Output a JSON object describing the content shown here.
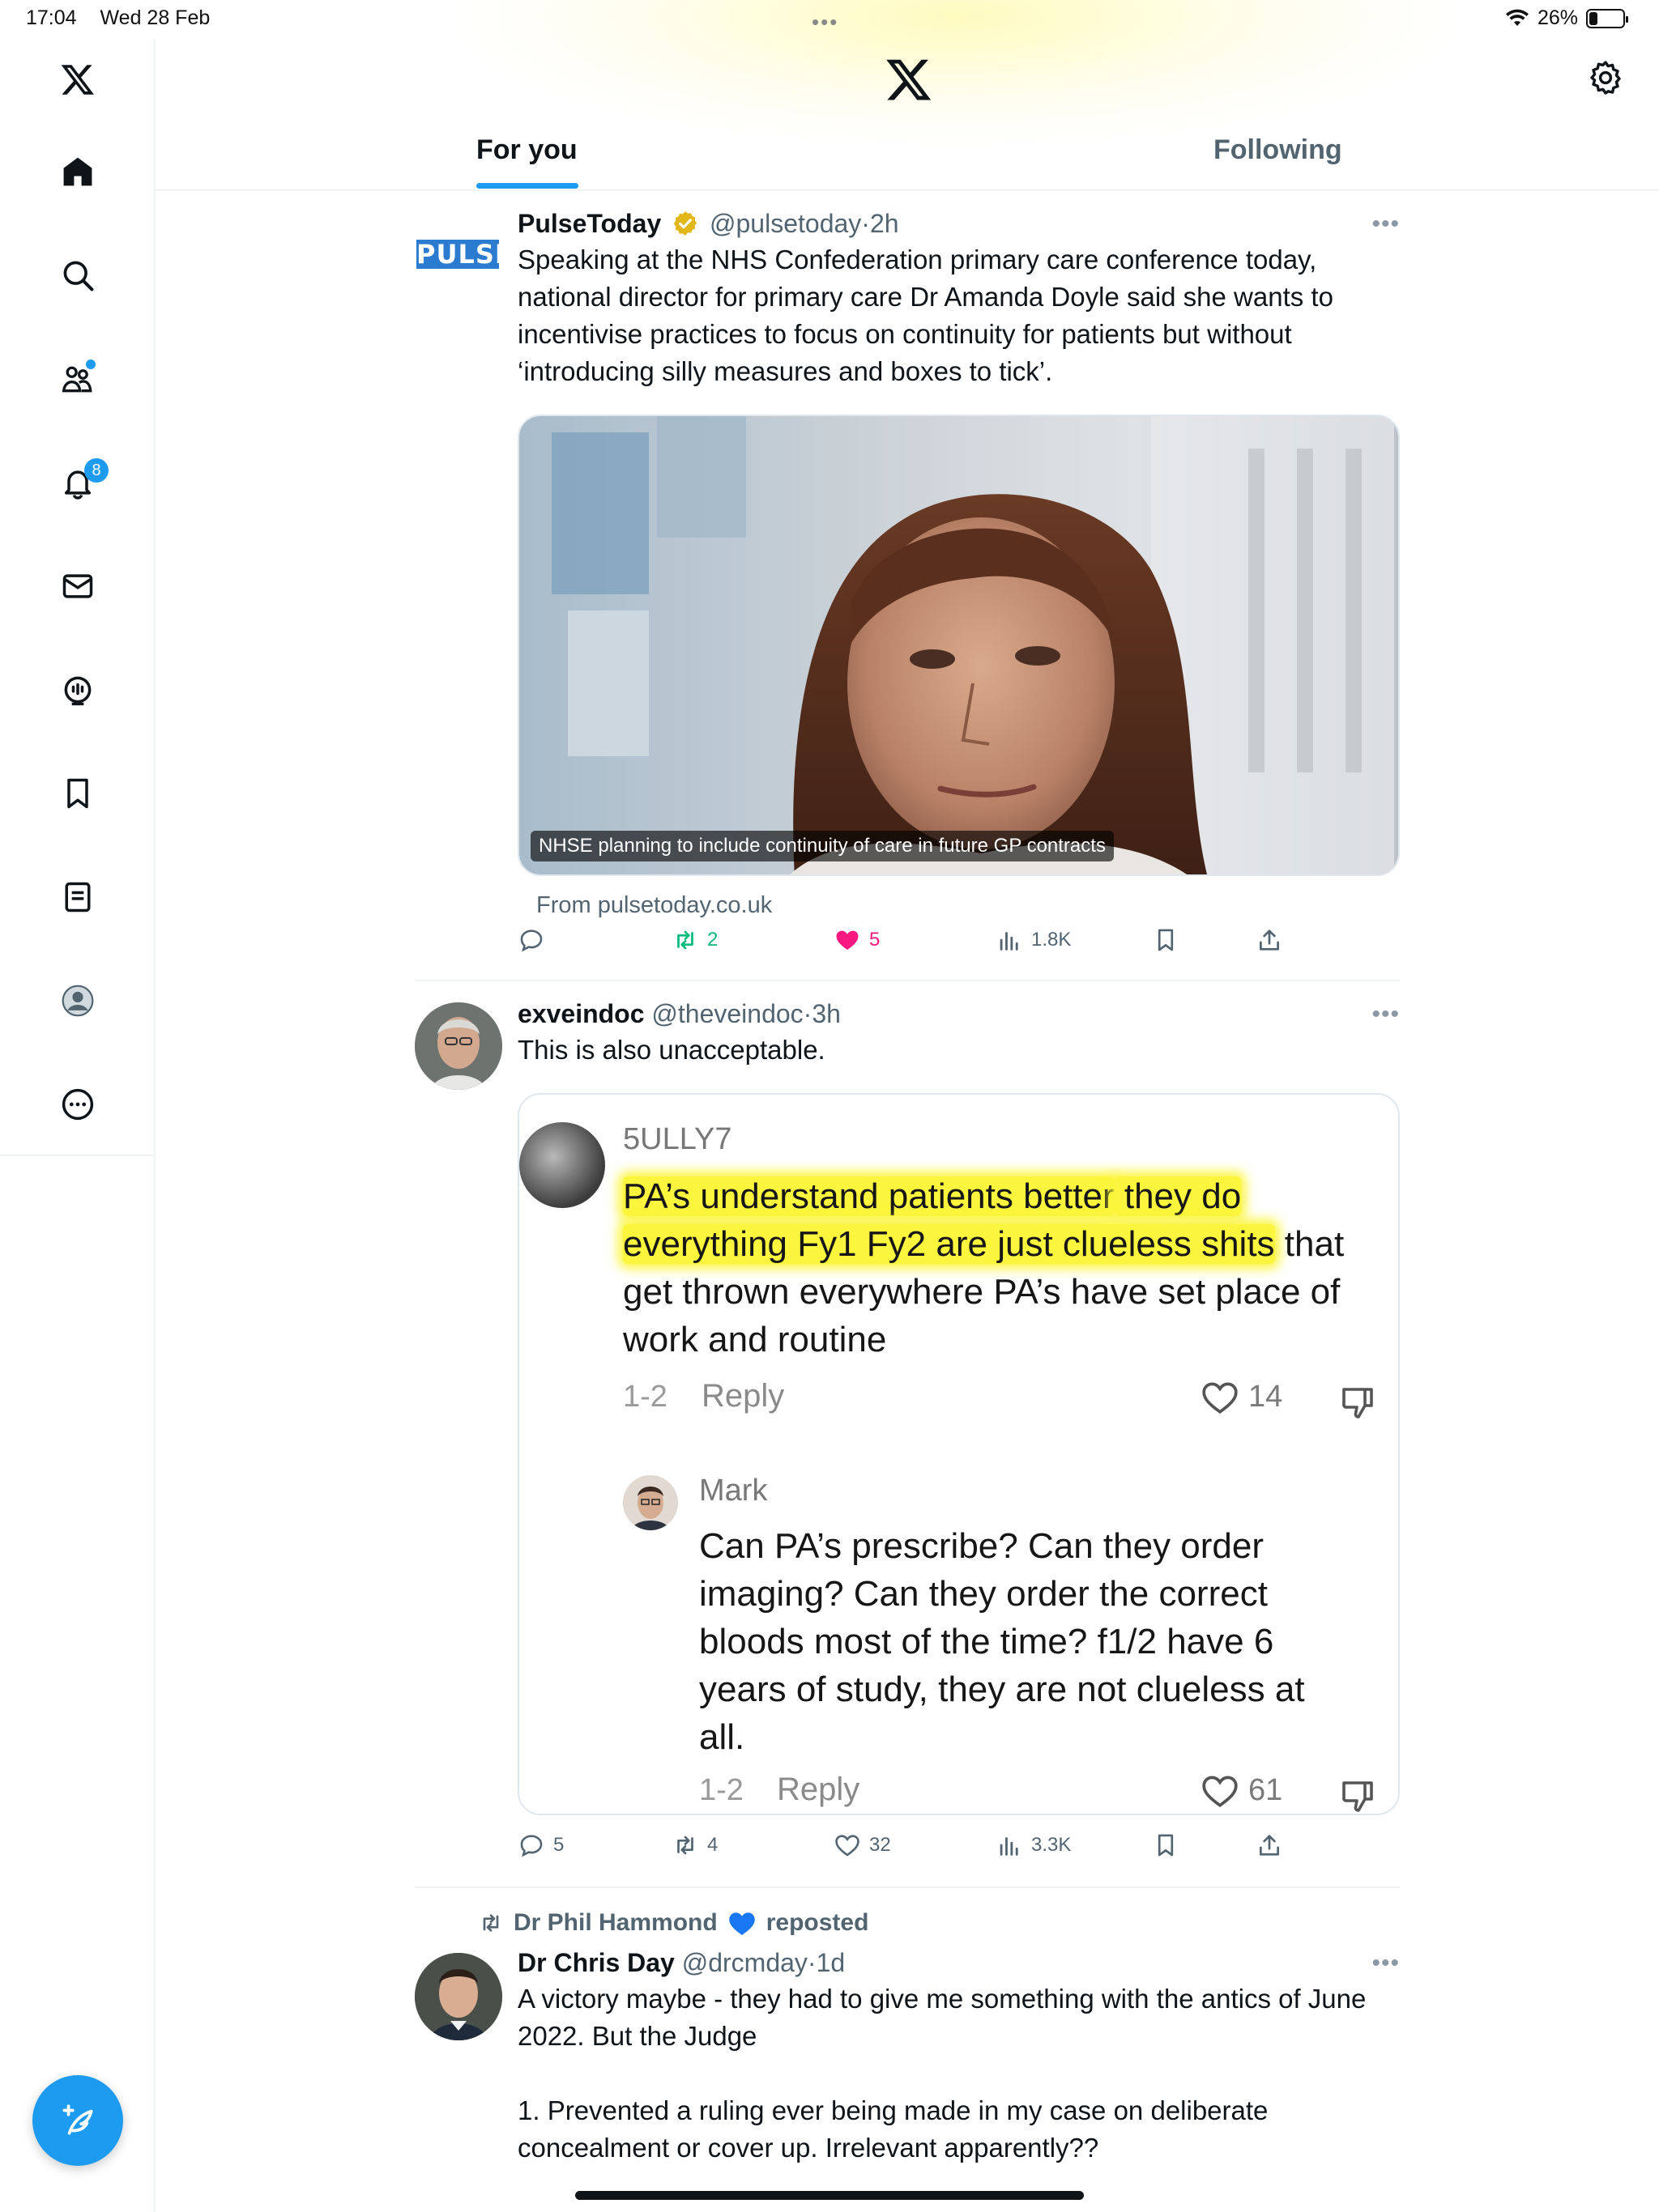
{
  "status_bar": {
    "time": "17:04",
    "date": "Wed 28 Feb",
    "battery": "26%",
    "battery_level": 0.26
  },
  "header": {
    "tabs": [
      {
        "label": "For you",
        "active": true
      },
      {
        "label": "Following",
        "active": false
      }
    ]
  },
  "sidebar": {
    "items": [
      {
        "name": "home",
        "icon": "home-icon"
      },
      {
        "name": "explore",
        "icon": "search-icon"
      },
      {
        "name": "communities",
        "icon": "people-icon",
        "dot": true
      },
      {
        "name": "notifications",
        "icon": "bell-icon",
        "badge": "8"
      },
      {
        "name": "messages",
        "icon": "mail-icon"
      },
      {
        "name": "spaces",
        "icon": "microphone-icon"
      },
      {
        "name": "bookmarks",
        "icon": "bookmark-icon"
      },
      {
        "name": "lists",
        "icon": "list-icon"
      },
      {
        "name": "profile",
        "icon": "profile-icon"
      },
      {
        "name": "more",
        "icon": "more-circle-icon"
      }
    ]
  },
  "colors": {
    "accent": "#1d9bf0",
    "like": "#f91880",
    "repost": "#00ba7c",
    "secondary": "#536471",
    "highlight": "#fbf53d"
  },
  "tweets": [
    {
      "name": "PulseToday",
      "verified": true,
      "handle": "@pulsetoday",
      "time": "2h",
      "avatar_logo": "PULSE",
      "text": "Speaking at the NHS Confederation primary care conference today, national director for primary care Dr Amanda Doyle said she wants to incentivise practices to focus on continuity for patients but without ‘introducing silly measures and boxes to tick’.",
      "media_caption": "NHSE planning to include continuity of care in future GP contracts",
      "source": "From pulsetoday.co.uk",
      "stats": {
        "replies": "",
        "reposts": "2",
        "likes": "5",
        "views": "1.8K"
      }
    },
    {
      "name": "exveindoc",
      "handle": "@theveindoc",
      "time": "3h",
      "text": "This is also unacceptable.",
      "embedded": {
        "comment1": {
          "user": "5ULLY7",
          "text_highlighted_1": "PA’s understand patients better",
          "text_highlighted_2": " they do",
          "text_highlighted_3": "everything Fy1 Fy2 are just clueless shits",
          "text_plain_1": " that",
          "text_plain_2": "get thrown everywhere PA’s have set place of",
          "text_plain_3": "work and routine",
          "date": "1-2",
          "reply": "Reply",
          "likes": "14"
        },
        "comment2": {
          "user": "Mark",
          "lines": [
            "Can PA’s prescribe? Can they order",
            "imaging? Can they order the correct",
            "bloods most of the time? f1/2 have 6",
            "years of study, they are not clueless at",
            "all."
          ],
          "date": "1-2",
          "reply": "Reply",
          "likes": "61"
        }
      },
      "stats": {
        "replies": "5",
        "reposts": "4",
        "likes": "32",
        "views": "3.3K"
      }
    },
    {
      "reposted_by": "Dr Phil Hammond",
      "reposted_suffix": "reposted",
      "name": "Dr Chris Day",
      "handle": "@drcmday",
      "time": "1d",
      "text_lines": [
        "A victory maybe - they had to give me something with the antics of June 2022. But the Judge",
        "",
        "1. Prevented a ruling ever being made in my case on deliberate concealment or cover up. Irrelevant apparently??"
      ]
    }
  ]
}
